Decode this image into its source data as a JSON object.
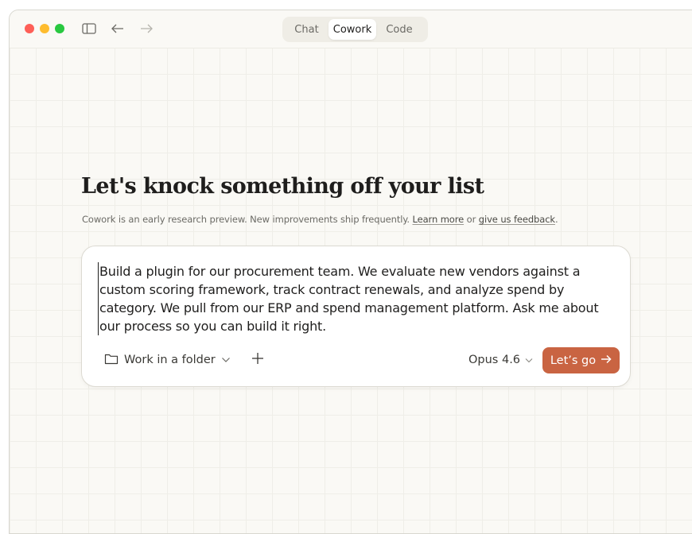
{
  "titlebar": {
    "modes": [
      {
        "label": "Chat",
        "active": false
      },
      {
        "label": "Cowork",
        "active": true
      },
      {
        "label": "Code",
        "active": false
      }
    ],
    "icons": [
      "sidebar-toggle-icon",
      "back-arrow-icon",
      "forward-arrow-icon"
    ]
  },
  "main": {
    "headline": "Let's knock something off your list",
    "subline": {
      "text": "Cowork is an early research preview. New improvements ship frequently. ",
      "learn_more": "Learn more",
      "or": " or ",
      "feedback": "give us feedback",
      "end": "."
    }
  },
  "composer": {
    "prompt": "Build a plugin for our procurement team. We evaluate new vendors against a custom scoring framework, track contract renewals, and analyze spend by category. We pull from our ERP and spend management platform. Ask me about our process so you can build it right.",
    "folder_label": "Work in a folder",
    "model_label": "Opus 4.6",
    "submit_label": "Let’s go"
  },
  "colors": {
    "accent": "#c96442",
    "background": "#faf9f5",
    "text": "#1f1e1d",
    "muted": "#6b6a65"
  }
}
